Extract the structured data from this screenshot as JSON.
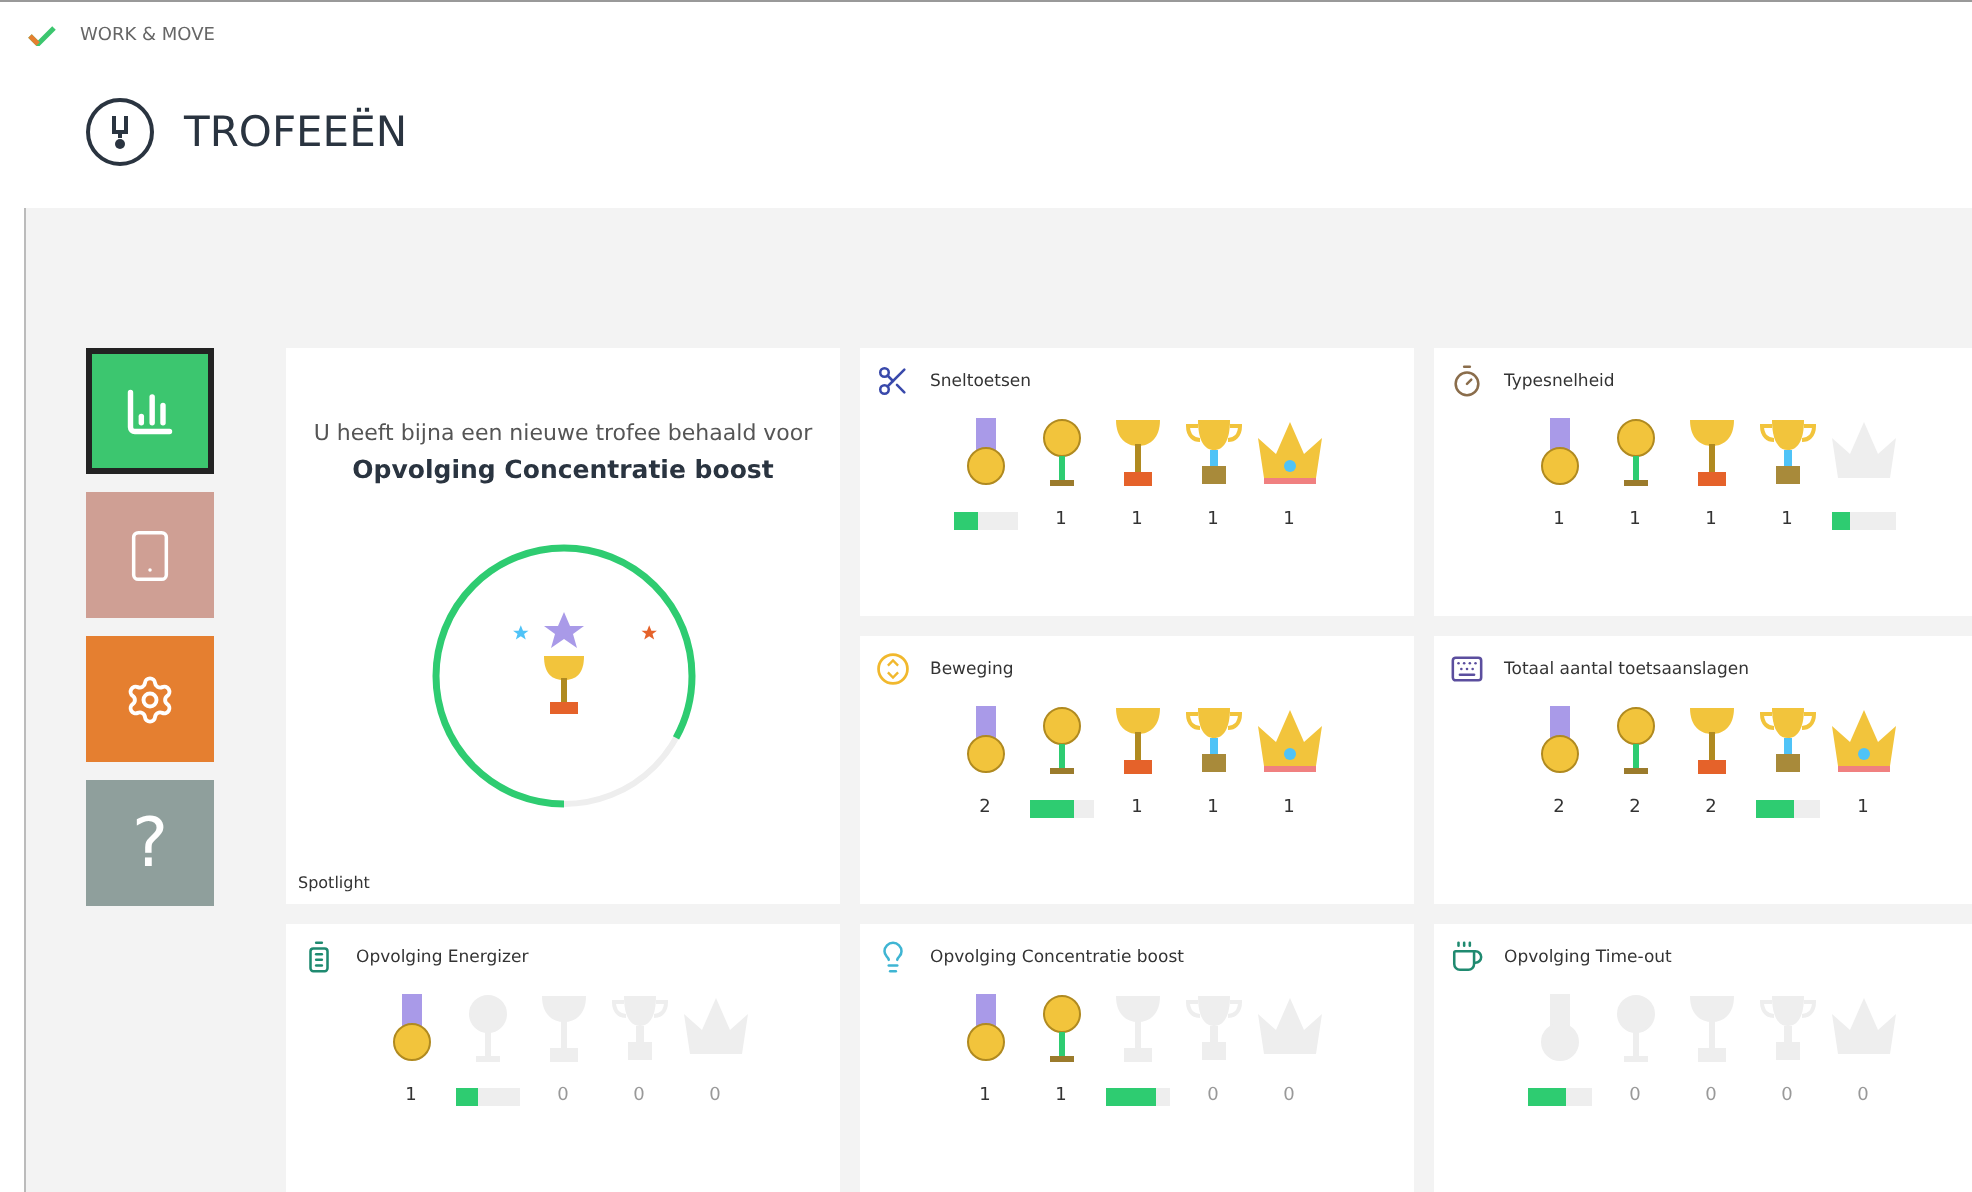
{
  "app": {
    "name": "WORK & MOVE"
  },
  "page": {
    "title": "TROFEEËN"
  },
  "sidebar": {
    "items": [
      {
        "selected": true,
        "color": "#3cc66f"
      },
      {
        "selected": false,
        "color": "#cf9f94"
      },
      {
        "selected": false,
        "color": "#e57f30"
      },
      {
        "selected": false,
        "color": "#8f9f9c",
        "label": "?"
      }
    ]
  },
  "spotlight": {
    "intro": "U heeft bijna een nieuwe trofee behaald voor",
    "subject": "Opvolging Concentratie boost",
    "caption": "Spotlight"
  },
  "cards": [
    {
      "title": "Sneltoetsen",
      "slots": [
        {
          "earned": true,
          "level": 0.4
        },
        {
          "earned": true,
          "count": "1"
        },
        {
          "earned": true,
          "count": "1"
        },
        {
          "earned": true,
          "count": "1"
        },
        {
          "earned": true,
          "count": "1"
        }
      ]
    },
    {
      "title": "Typesnelheid",
      "slots": [
        {
          "earned": true,
          "count": "1"
        },
        {
          "earned": true,
          "count": "1"
        },
        {
          "earned": true,
          "count": "1"
        },
        {
          "earned": true,
          "count": "1"
        },
        {
          "earned": false,
          "level": 0.3
        }
      ]
    },
    {
      "title": "Beweging",
      "slots": [
        {
          "earned": true,
          "count": "2"
        },
        {
          "earned": true,
          "level": 0.7
        },
        {
          "earned": true,
          "count": "1"
        },
        {
          "earned": true,
          "count": "1"
        },
        {
          "earned": true,
          "count": "1"
        }
      ]
    },
    {
      "title": "Totaal aantal toetsaanslagen",
      "slots": [
        {
          "earned": true,
          "count": "2"
        },
        {
          "earned": true,
          "count": "2"
        },
        {
          "earned": true,
          "count": "2"
        },
        {
          "earned": true,
          "level": 0.6
        },
        {
          "earned": true,
          "count": "1"
        }
      ]
    },
    {
      "title": "Opvolging Energizer",
      "slots": [
        {
          "earned": true,
          "count": "1"
        },
        {
          "earned": false,
          "level": 0.35
        },
        {
          "earned": false,
          "count": "0"
        },
        {
          "earned": false,
          "count": "0"
        },
        {
          "earned": false,
          "count": "0"
        }
      ]
    },
    {
      "title": "Opvolging Concentratie boost",
      "slots": [
        {
          "earned": true,
          "count": "1"
        },
        {
          "earned": true,
          "count": "1"
        },
        {
          "earned": false,
          "level": 0.8
        },
        {
          "earned": false,
          "count": "0"
        },
        {
          "earned": false,
          "count": "0"
        }
      ]
    },
    {
      "title": "Opvolging Time-out",
      "slots": [
        {
          "earned": false,
          "level": 0.6
        },
        {
          "earned": false,
          "count": "0"
        },
        {
          "earned": false,
          "count": "0"
        },
        {
          "earned": false,
          "count": "0"
        },
        {
          "earned": false,
          "count": "0"
        }
      ]
    }
  ]
}
